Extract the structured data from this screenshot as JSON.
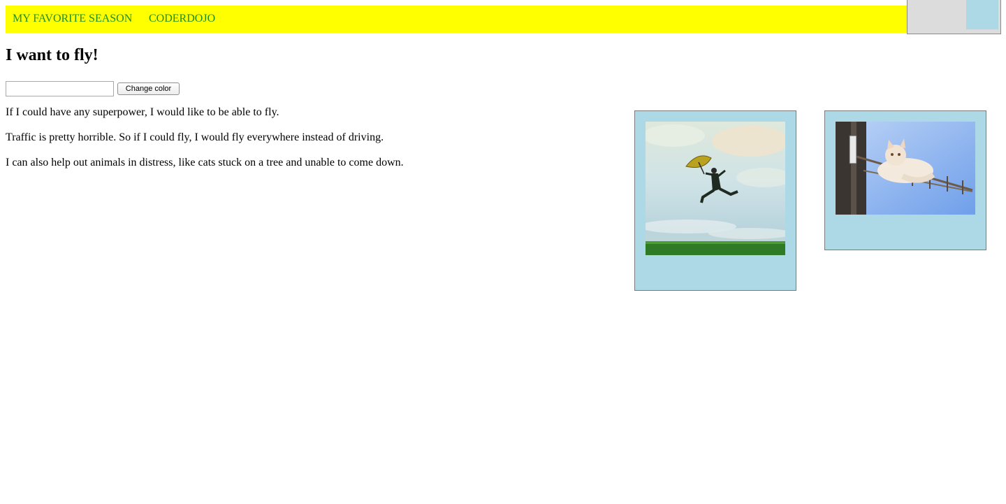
{
  "nav": {
    "items": [
      "MY FAVORITE SEASON",
      "CODERDOJO"
    ],
    "background": "#ffff00",
    "link_color": "#1f8f1f"
  },
  "corner_box": {
    "background": "#dcdcdc",
    "swatch_color": "#add8e6"
  },
  "page": {
    "heading": "I want to fly!"
  },
  "color_form": {
    "input_value": "",
    "input_placeholder": "",
    "button_label": "Change color"
  },
  "content": {
    "paragraphs": [
      "If I could have any superpower, I would like to be able to fly.",
      "Traffic is pretty horrible. So if I could fly, I would fly everywhere instead of driving.",
      "I can also help out animals in distress, like cats stuck on a tree and unable to come down."
    ]
  },
  "gallery": {
    "card_color": "#add8e6",
    "images": [
      {
        "subject": "person-flying-with-umbrella"
      },
      {
        "subject": "cat-on-antenna"
      }
    ]
  }
}
